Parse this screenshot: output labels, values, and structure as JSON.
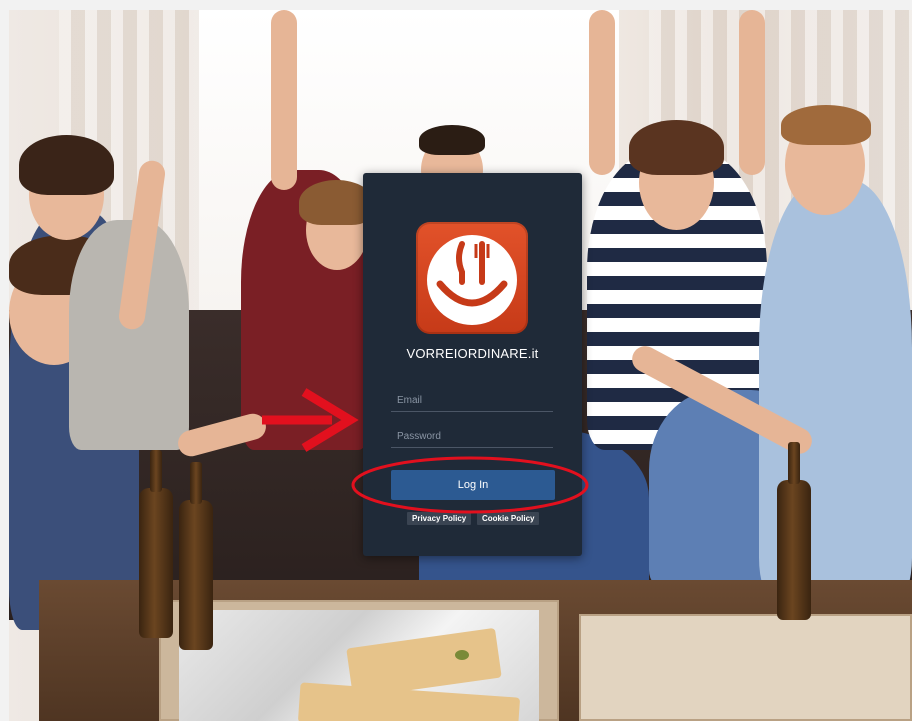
{
  "brand": {
    "name": "VORREIORDINARE.it"
  },
  "login": {
    "email_placeholder": "Email",
    "password_placeholder": "Password",
    "submit_label": "Log In"
  },
  "footer": {
    "privacy_label": "Privacy Policy",
    "cookie_label": "Cookie Policy"
  },
  "colors": {
    "card_bg": "#1f2a38",
    "button_bg": "#2c5a92",
    "logo_red": "#d4441f",
    "annotation_red": "#e2101e"
  },
  "icons": {
    "logo": "smiley-fork-knife-icon",
    "arrow": "red-arrow-annotation",
    "circle": "red-ellipse-annotation"
  }
}
